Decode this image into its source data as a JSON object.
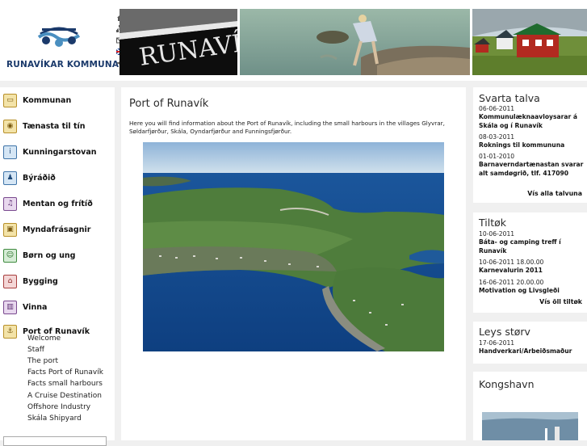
{
  "header": {
    "logo_text": "RUNAVÍKAR KOMMUNA",
    "boat_lettering": "RUNAVÍ",
    "brand_color": "#1b3a6b"
  },
  "icons": [
    "home-icon",
    "sitemap-icon",
    "mail-icon",
    "flag-icon",
    "speaker-icon"
  ],
  "sidebar": {
    "items": [
      {
        "label": "Kommunan",
        "icon": "town-hall-icon"
      },
      {
        "label": "Tænasta til tín",
        "icon": "service-icon"
      },
      {
        "label": "Kunningarstovan",
        "icon": "info-icon"
      },
      {
        "label": "Býráðið",
        "icon": "council-icon"
      },
      {
        "label": "Mentan og frítíð",
        "icon": "culture-icon"
      },
      {
        "label": "Myndafrásagnir",
        "icon": "photo-icon"
      },
      {
        "label": "Børn og ung",
        "icon": "children-icon"
      },
      {
        "label": "Bygging",
        "icon": "building-icon"
      },
      {
        "label": "Vinna",
        "icon": "work-icon"
      },
      {
        "label": "Port of Runavík",
        "icon": "port-icon"
      }
    ],
    "subitems": [
      "Welcome",
      "Staff",
      "The port",
      "Facts Port of Runavík",
      "Facts small harbours",
      "A Cruise Destination",
      "Offshore Industry",
      "Skála Shipyard"
    ]
  },
  "main": {
    "title": "Port of Runavík",
    "intro": "Here you will find information about the Port of Runavík, including the small harbours in the villages Glyvrar, Søldarfjørður, Skála, Oyndarfjørður and Funningsfjørður."
  },
  "right": {
    "svarta": {
      "title": "Svarta talva",
      "entries": [
        {
          "date": "06-06-2011",
          "text": "Kommunulæknaavloysarar á Skála og í Runavík"
        },
        {
          "date": "08-03-2011",
          "text": "Roknings til kommununa"
        },
        {
          "date": "01-01-2010",
          "text": "Barnaverndartænastan svarar alt samdøgrið, tlf. 417090"
        }
      ],
      "more": "Vís alla talvuna"
    },
    "tiltok": {
      "title": "Tiltøk",
      "entries": [
        {
          "date": "10-06-2011",
          "text": "Báta- og camping treff í Runavík"
        },
        {
          "date": "10-06-2011 18.00.00",
          "text": "Karnevalurin 2011"
        },
        {
          "date": "16-06-2011 20.00.00",
          "text": "Motivation og Livsgleði"
        }
      ],
      "more": "Vís öll tiltøk"
    },
    "leys": {
      "title": "Leys størv",
      "entries": [
        {
          "date": "17-06-2011",
          "text": "Handverkari/Arbeiðsmaður"
        }
      ]
    },
    "kongshavn": {
      "title": "Kongshavn"
    }
  }
}
